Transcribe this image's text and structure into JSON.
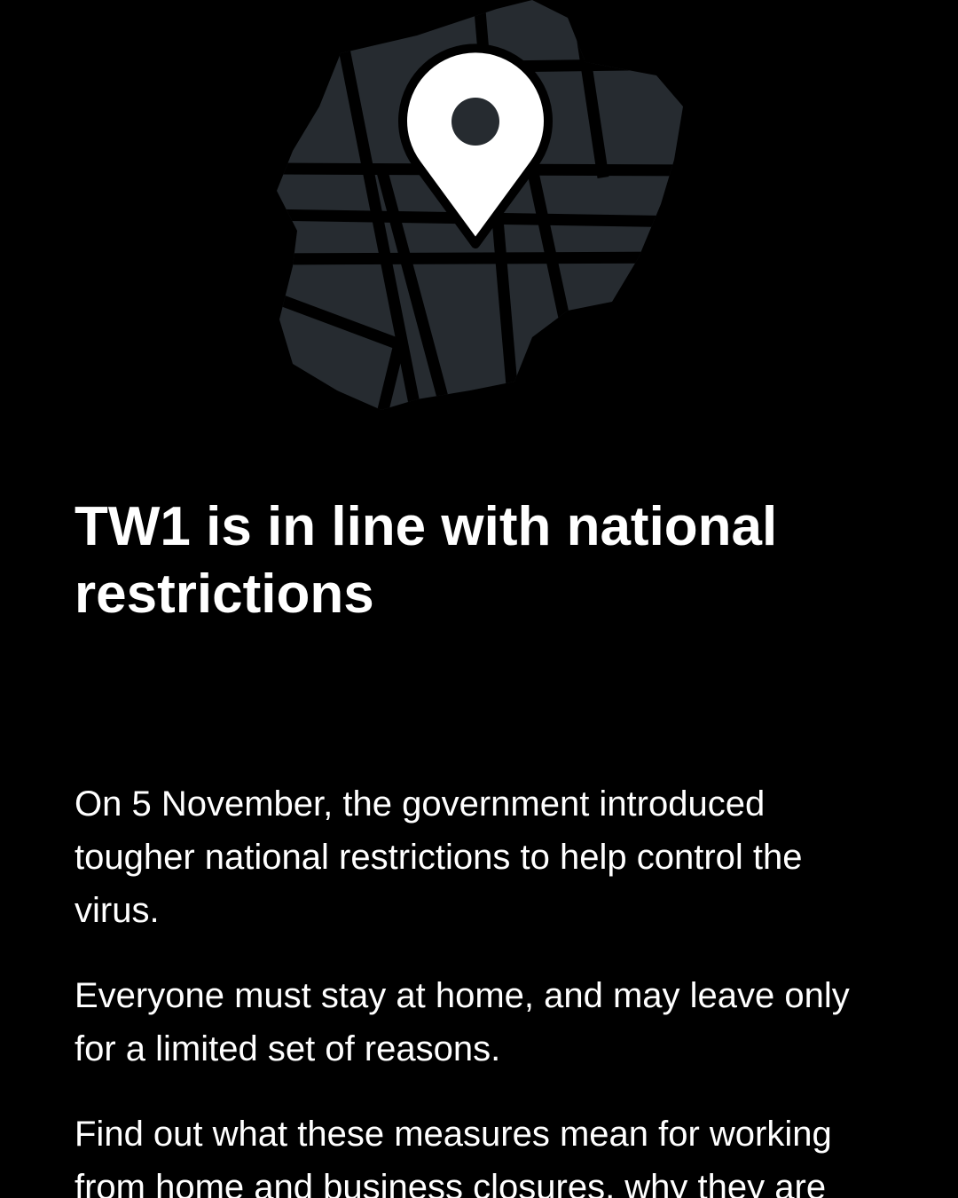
{
  "colors": {
    "background": "#000000",
    "map_fill": "#262b30",
    "pin_fill": "#ffffff",
    "text": "#ffffff"
  },
  "hero": {
    "icon": "map-location-pin-icon"
  },
  "title": "TW1 is in line with national restrictions",
  "paragraphs": [
    "On 5 November, the government introduced tougher national restrictions to help control the virus.",
    "Everyone must stay at home, and may leave only for a limited set of reasons.",
    "Find out what these measures mean for working from home and business closures, why they are"
  ]
}
